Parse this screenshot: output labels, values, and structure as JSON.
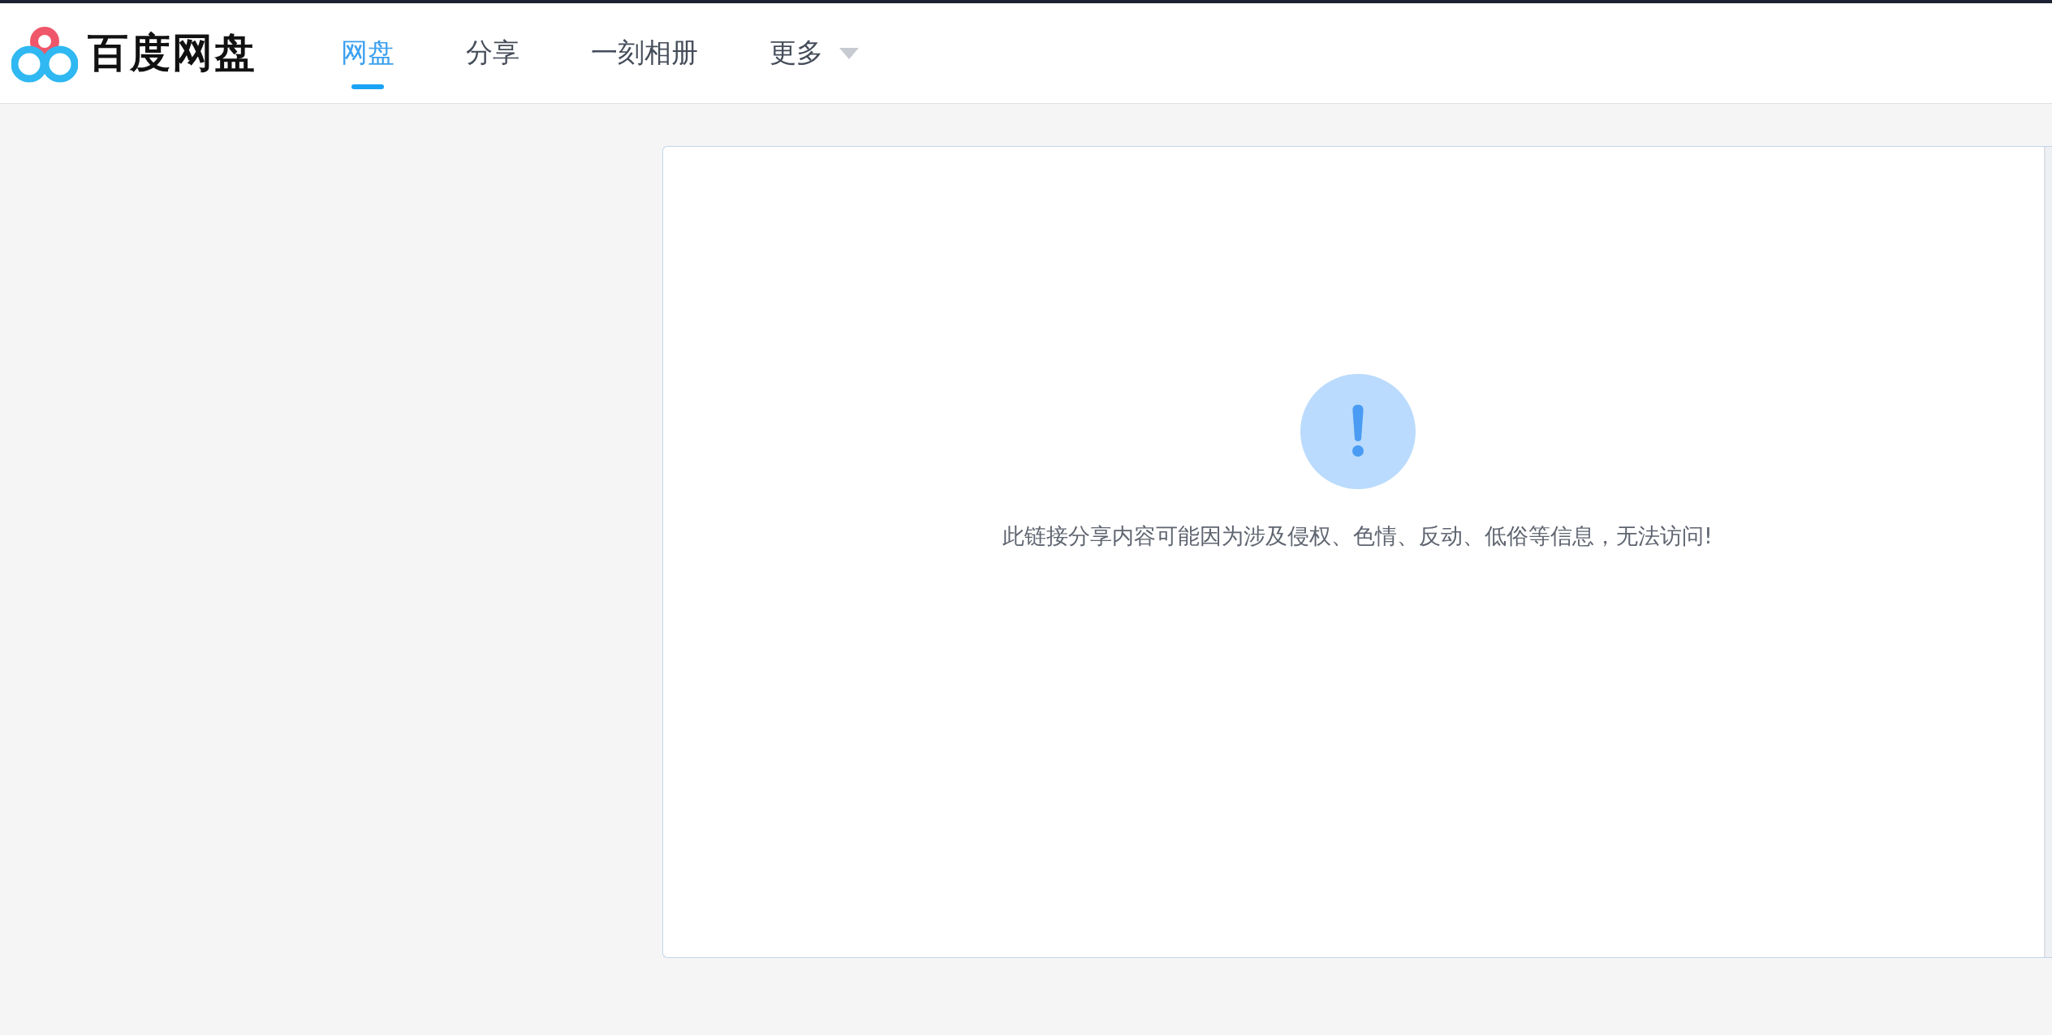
{
  "header": {
    "logo_text": "百度网盘",
    "nav": [
      {
        "label": "网盘",
        "selected": true,
        "kind": "link"
      },
      {
        "label": "分享",
        "selected": false,
        "kind": "link"
      },
      {
        "label": "一刻相册",
        "selected": false,
        "kind": "link"
      },
      {
        "label": "更多",
        "selected": false,
        "kind": "dropdown"
      }
    ]
  },
  "notice": {
    "message": "此链接分享内容可能因为涉及侵权、色情、反动、低俗等信息，无法访问!"
  }
}
